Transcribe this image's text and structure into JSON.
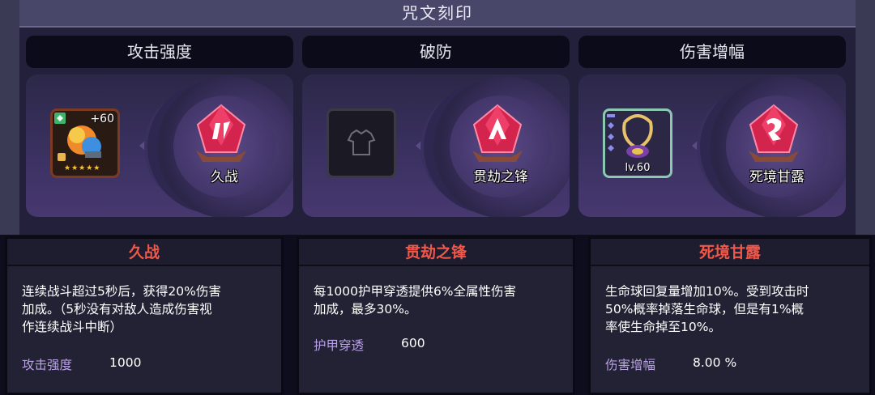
{
  "title": "咒文刻印",
  "slots": [
    {
      "header": "攻击强度",
      "rune_name": "久战",
      "item": {
        "level_badge": "+60",
        "stars": "★★★★★"
      }
    },
    {
      "header": "破防",
      "rune_name": "贯劫之锋",
      "item": {
        "icon": "shirt-icon"
      }
    },
    {
      "header": "伤害增幅",
      "rune_name": "死境甘露",
      "item": {
        "level": "lv.60"
      }
    }
  ],
  "panels": [
    {
      "title": "久战",
      "desc": [
        "连续战斗超过5秒后，获得20%伤害",
        "加成。（5秒没有对敌人造成伤害视",
        "作连续战斗中断）"
      ],
      "stat_label": "攻击强度",
      "stat_value": "1000"
    },
    {
      "title": "贯劫之锋",
      "desc": [
        "每1000护甲穿透提供6%全属性伤害",
        "加成，最多30%。"
      ],
      "stat_label": "护甲穿透",
      "stat_value": "600"
    },
    {
      "title": "死境甘露",
      "desc": [
        "生命球回复量增加10%。受到攻击时",
        "50%概率掉落生命球，但是有1%概",
        "率使生命掉至10%。"
      ],
      "stat_label": "伤害增幅",
      "stat_value": "8.00 %"
    }
  ],
  "colors": {
    "accent_title": "#f0584a",
    "stat_label": "#b9a2e6",
    "crystal": "#d2244c"
  }
}
